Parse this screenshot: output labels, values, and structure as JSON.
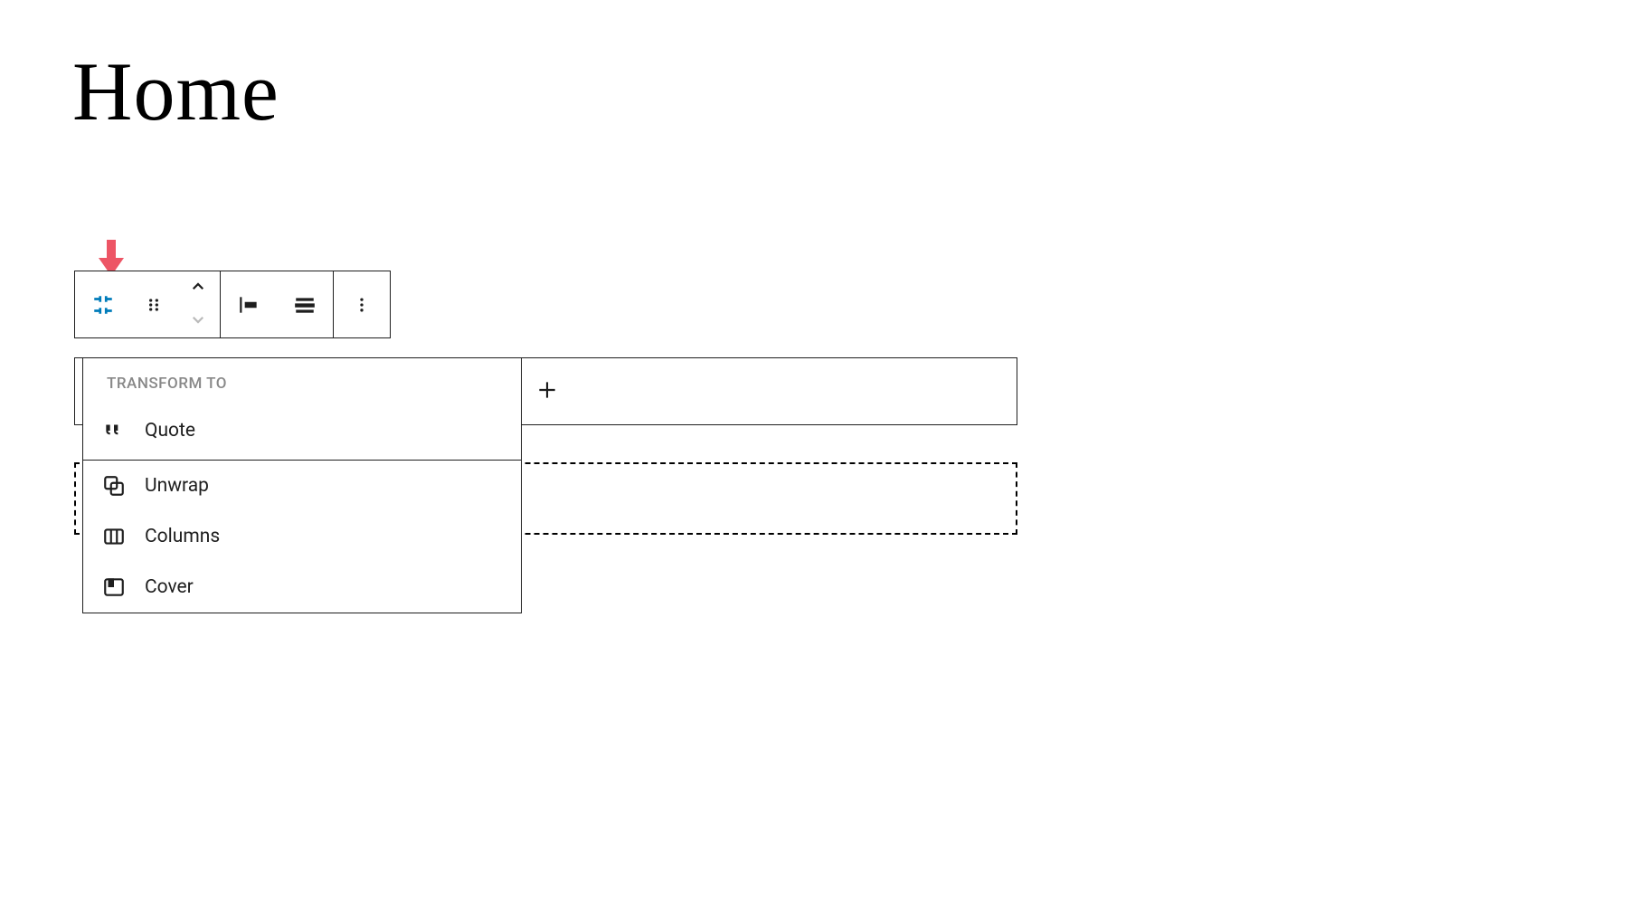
{
  "page": {
    "title": "Home"
  },
  "toolbar": {
    "colors": {
      "active_icon": "#007cba"
    }
  },
  "dropdown": {
    "header": "TRANSFORM TO",
    "items": [
      {
        "icon": "quote",
        "label": "Quote",
        "bordered": true
      },
      {
        "icon": "unwrap",
        "label": "Unwrap",
        "bordered": false
      },
      {
        "icon": "columns",
        "label": "Columns",
        "bordered": false
      },
      {
        "icon": "cover",
        "label": "Cover",
        "bordered": false
      }
    ]
  }
}
